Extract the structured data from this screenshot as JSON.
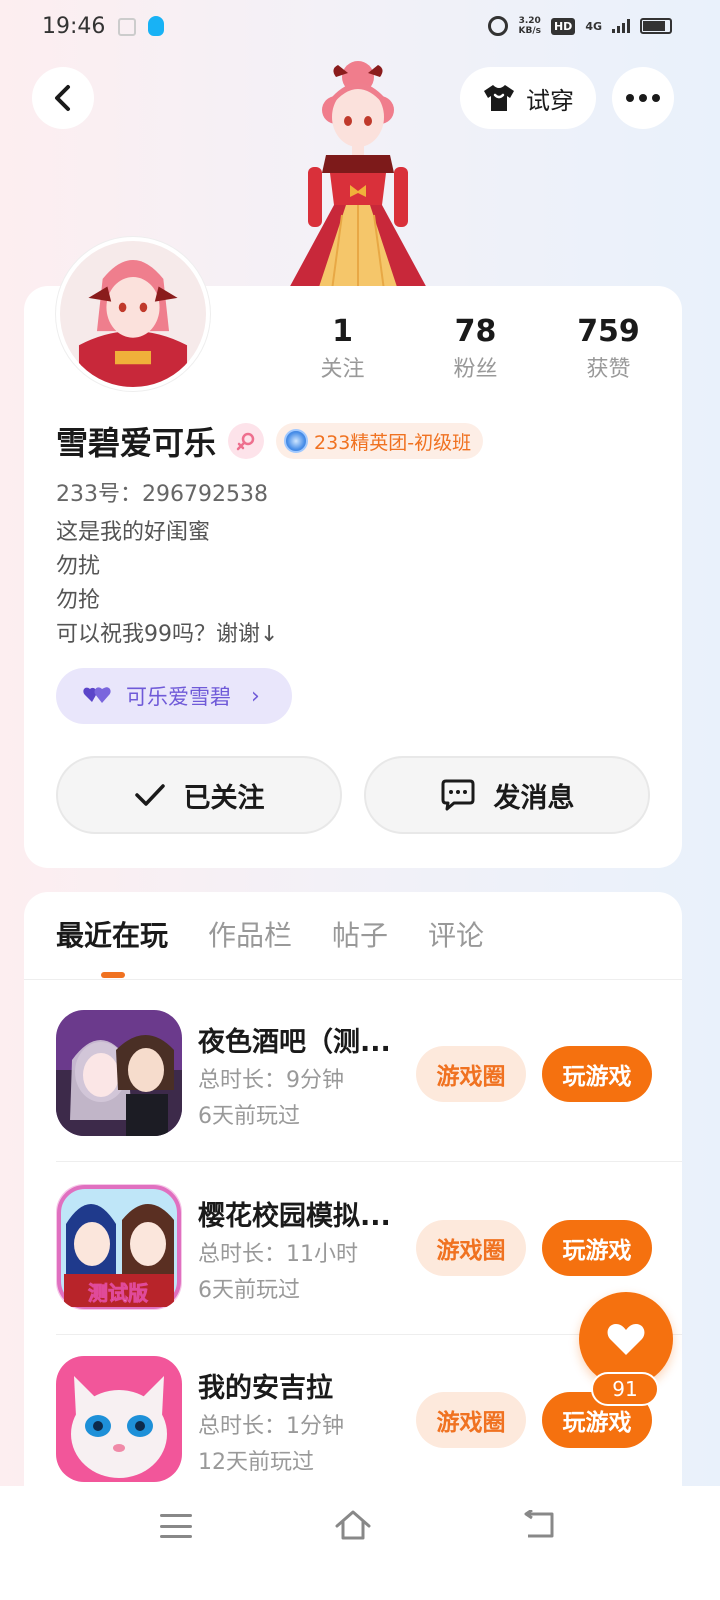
{
  "status_bar": {
    "time": "19:46",
    "net_speed_value": "3.20",
    "net_speed_unit": "KB/s",
    "hd": "HD",
    "network": "4G"
  },
  "header": {
    "try_on_label": "试穿"
  },
  "profile": {
    "stats": [
      {
        "value": "1",
        "label": "关注"
      },
      {
        "value": "78",
        "label": "粉丝"
      },
      {
        "value": "759",
        "label": "获赞"
      }
    ],
    "username": "雪碧爱可乐",
    "title_badge": "233精英团-初级班",
    "user_id": "233号：296792538",
    "bio_lines": [
      "这是我的好闺蜜",
      "勿扰",
      "勿抢",
      "可以祝我99吗？谢谢↓"
    ],
    "friend_tag": "可乐爱雪碧",
    "follow_label": "已关注",
    "message_label": "发消息"
  },
  "tabs": [
    {
      "label": "最近在玩",
      "active": true
    },
    {
      "label": "作品栏",
      "active": false
    },
    {
      "label": "帖子",
      "active": false
    },
    {
      "label": "评论",
      "active": false
    }
  ],
  "games": [
    {
      "name": "夜色酒吧（测...",
      "duration": "总时长：9分钟",
      "last_played": "6天前玩过",
      "circle_label": "游戏圈",
      "play_label": "玩游戏"
    },
    {
      "name": "樱花校园模拟...",
      "duration": "总时长：11小时",
      "last_played": "6天前玩过",
      "circle_label": "游戏圈",
      "play_label": "玩游戏",
      "icon_badge": "测试版"
    },
    {
      "name": "我的安吉拉",
      "duration": "总时长：1分钟",
      "last_played": "12天前玩过",
      "circle_label": "游戏圈",
      "play_label": "玩游戏"
    }
  ],
  "like": {
    "count": "91"
  },
  "colors": {
    "accent": "#f5710f",
    "accent_light": "#fde9dc",
    "tag_purple": "#6f5ad8"
  }
}
